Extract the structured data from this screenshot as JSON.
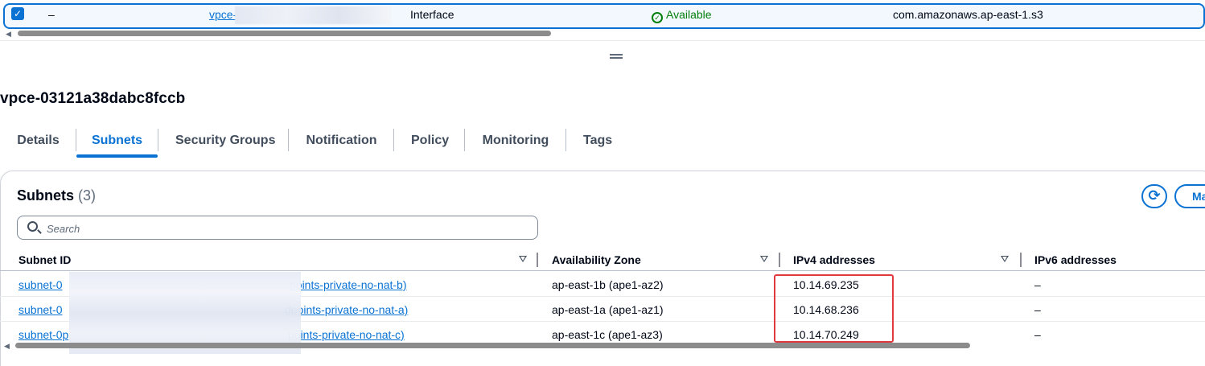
{
  "top_row": {
    "dash": "–",
    "endpoint_id_prefix": "vpce-",
    "type": "Interface",
    "status": "Available",
    "service_name": "com.amazonaws.ap-east-1.s3"
  },
  "page_title": "vpce-03121a38dabc8fccb",
  "tabs": [
    {
      "label": "Details",
      "active": false
    },
    {
      "label": "Subnets",
      "active": true
    },
    {
      "label": "Security Groups",
      "active": false
    },
    {
      "label": "Notification",
      "active": false
    },
    {
      "label": "Policy",
      "active": false
    },
    {
      "label": "Monitoring",
      "active": false
    },
    {
      "label": "Tags",
      "active": false
    }
  ],
  "subnets_panel": {
    "title": "Subnets",
    "count": "(3)",
    "manage_label": "Ma",
    "search_placeholder": "Search",
    "columns": [
      "Subnet ID",
      "Availability Zone",
      "IPv4 addresses",
      "IPv6 addresses"
    ],
    "rows": [
      {
        "subnet_prefix": "subnet-0",
        "subnet_suffix": "points-private-no-nat-b)",
        "az": "ap-east-1b (ape1-az2)",
        "ipv4": "10.14.69.235",
        "ipv6": "–"
      },
      {
        "subnet_prefix": "subnet-0",
        "subnet_suffix": "dpoints-private-no-nat-a)",
        "az": "ap-east-1a (ape1-az1)",
        "ipv4": "10.14.68.236",
        "ipv6": "–"
      },
      {
        "subnet_prefix": "subnet-0p",
        "subnet_suffix": "points-private-no-nat-c)",
        "az": "ap-east-1c (ape1-az3)",
        "ipv4": "10.14.70.249",
        "ipv6": "–"
      }
    ]
  },
  "colors": {
    "accent": "#0972d3",
    "success": "#037f0c",
    "highlight": "#e0393e"
  },
  "icons": {
    "checkbox": "checkbox-checked-icon",
    "status": "status-available-icon",
    "search": "search-icon",
    "refresh": "refresh-icon",
    "sort": "sort-caret-icon"
  }
}
